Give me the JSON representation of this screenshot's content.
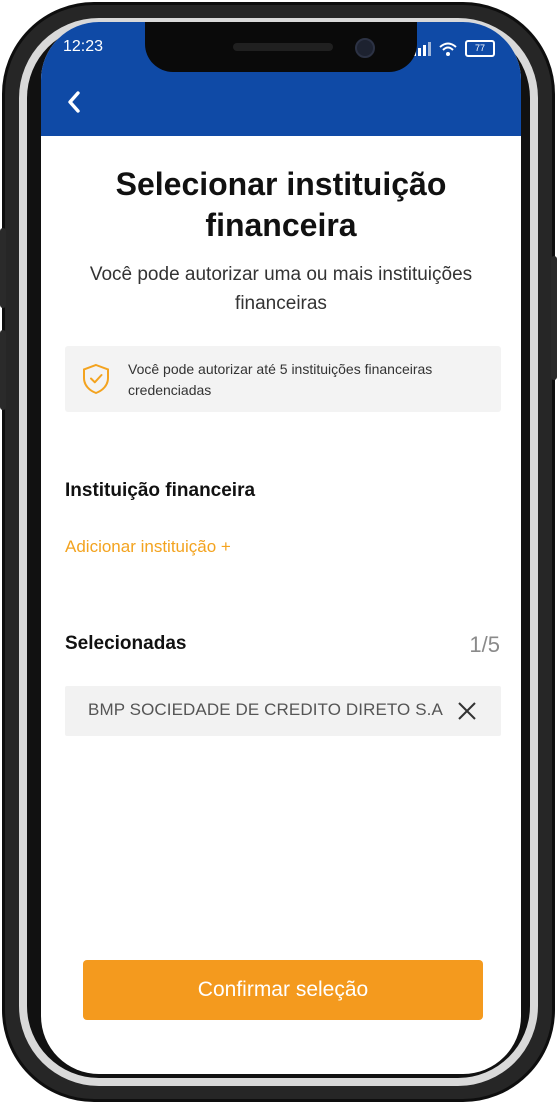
{
  "status_bar": {
    "time": "12:23",
    "battery": "77"
  },
  "header": {
    "back_icon": "chevron-left-icon",
    "color": "#0f4aa6"
  },
  "page": {
    "title": "Selecionar instituição financeira",
    "subtitle": "Você pode autorizar uma ou mais instituições financeiras"
  },
  "info_box": {
    "icon": "shield-check-icon",
    "text": "Você pode autorizar até 5 instituições financeiras credenciadas"
  },
  "institution_section": {
    "label": "Instituição financeira",
    "add_link": "Adicionar instituição +"
  },
  "selected_section": {
    "label": "Selecionadas",
    "count": "1/5",
    "items": [
      {
        "name": "BMP SOCIEDADE DE CREDITO DIRETO S.A",
        "remove_icon": "close-icon"
      }
    ]
  },
  "confirm_button": {
    "label": "Confirmar seleção"
  },
  "colors": {
    "accent": "#f49a1e",
    "link": "#f3a31f",
    "header": "#0f4aa6"
  }
}
